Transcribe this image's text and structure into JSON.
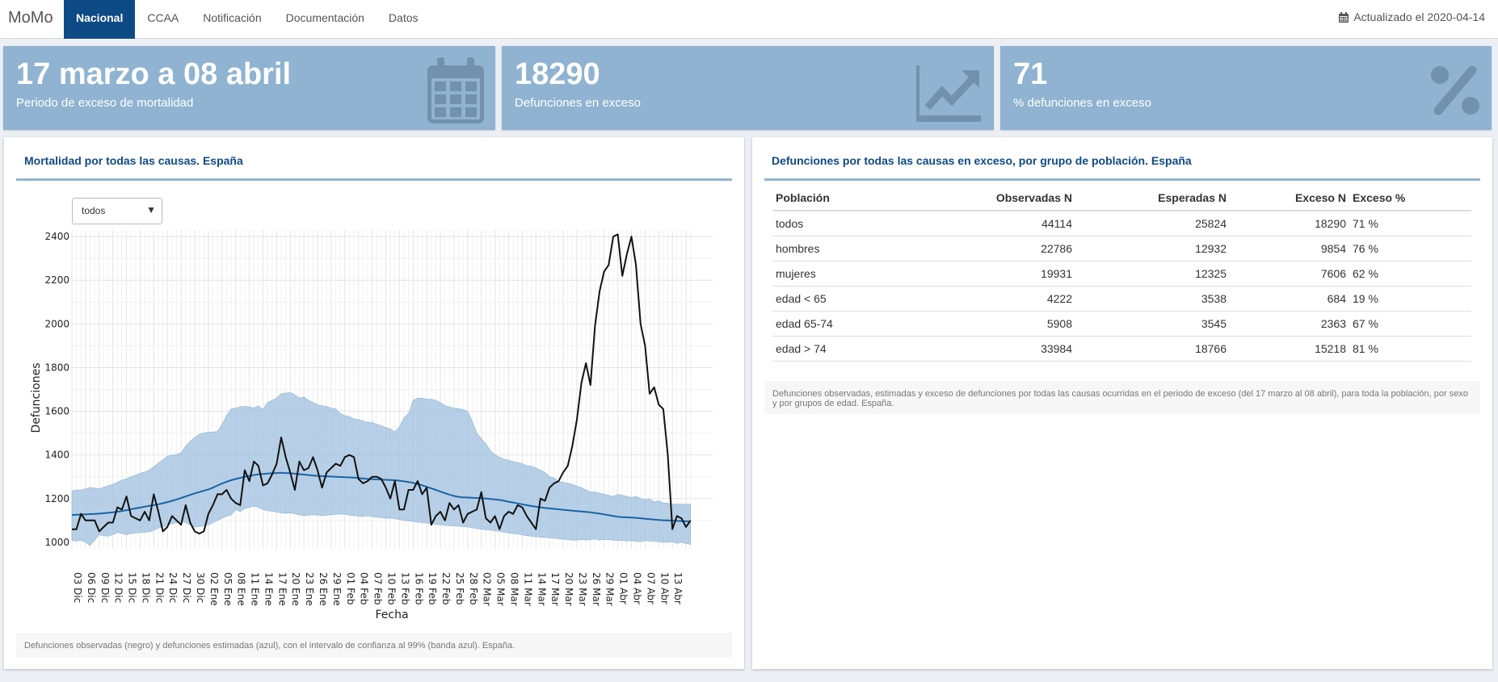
{
  "navbar": {
    "brand": "MoMo",
    "items": [
      {
        "label": "Nacional",
        "active": true
      },
      {
        "label": "CCAA"
      },
      {
        "label": "Notificación"
      },
      {
        "label": "Documentación"
      },
      {
        "label": "Datos"
      }
    ],
    "updated": "Actualizado el 2020-04-14"
  },
  "valueboxes": [
    {
      "value": "17 marzo a 08 abril",
      "subtitle": "Periodo de exceso de mortalidad",
      "icon": "calendar-icon"
    },
    {
      "value": "18290",
      "subtitle": "Defunciones en exceso",
      "icon": "chart-line-icon"
    },
    {
      "value": "71",
      "subtitle": "% defunciones en exceso",
      "icon": "percent-icon"
    }
  ],
  "colors": {
    "accent": "#0e4a86",
    "valuebox": "#8fb3d1",
    "band": "#9fc0df",
    "estimate": "#1a63a6",
    "observed": "#111111"
  },
  "left_panel": {
    "title": "Mortalidad por todas las causas. España",
    "select_value": "todos",
    "footer": "Defunciones observadas (negro) y defunciones estimadas (azul), con el intervalo de confianza al 99% (banda azul). España."
  },
  "right_panel": {
    "title": "Defunciones por todas las causas en exceso, por grupo de población. España",
    "table": {
      "headers": [
        "Población",
        "Observadas N",
        "Esperadas N",
        "Exceso N",
        "Exceso %"
      ],
      "rows": [
        [
          "todos",
          "44114",
          "25824",
          "18290",
          "71 %"
        ],
        [
          "hombres",
          "22786",
          "12932",
          "9854",
          "76 %"
        ],
        [
          "mujeres",
          "19931",
          "12325",
          "7606",
          "62 %"
        ],
        [
          "edad < 65",
          "4222",
          "3538",
          "684",
          "19 %"
        ],
        [
          "edad 65-74",
          "5908",
          "3545",
          "2363",
          "67 %"
        ],
        [
          "edad > 74",
          "33984",
          "18766",
          "15218",
          "81 %"
        ]
      ]
    },
    "footer": "Defunciones observadas, estimadas y exceso de defunciones por todas las causas ocurridas en el periodo de exceso (del 17 marzo al 08 abril), para toda la población, por sexo y por grupos de edad. España."
  },
  "chart_data": {
    "type": "line",
    "xlabel": "Fecha",
    "ylabel": "Defunciones",
    "ylim": [
      970,
      2430
    ],
    "yticks": [
      1000,
      1200,
      1400,
      1600,
      1800,
      2000,
      2200,
      2400
    ],
    "x_ticks": [
      "03 Dic",
      "06 Dic",
      "09 Dic",
      "12 Dic",
      "15 Dic",
      "18 Dic",
      "21 Dic",
      "24 Dic",
      "27 Dic",
      "30 Dic",
      "02 Ene",
      "05 Ene",
      "08 Ene",
      "11 Ene",
      "14 Ene",
      "17 Ene",
      "20 Ene",
      "23 Ene",
      "26 Ene",
      "29 Ene",
      "01 Feb",
      "04 Feb",
      "07 Feb",
      "10 Feb",
      "13 Feb",
      "16 Feb",
      "19 Feb",
      "22 Feb",
      "25 Feb",
      "28 Feb",
      "02 Mar",
      "05 Mar",
      "08 Mar",
      "11 Mar",
      "14 Mar",
      "17 Mar",
      "20 Mar",
      "23 Mar",
      "26 Mar",
      "29 Mar",
      "01 Abr",
      "04 Abr",
      "07 Abr",
      "10 Abr",
      "13 Abr"
    ],
    "grid": true,
    "series": [
      {
        "name": "observadas",
        "daily_from": "2019-12-03",
        "values": [
          1060,
          1060,
          1130,
          1100,
          1100,
          1100,
          1050,
          1070,
          1090,
          1090,
          1160,
          1150,
          1210,
          1120,
          1110,
          1100,
          1140,
          1100,
          1220,
          1140,
          1050,
          1070,
          1120,
          1100,
          1080,
          1170,
          1090,
          1050,
          1040,
          1050,
          1130,
          1170,
          1220,
          1220,
          1240,
          1200,
          1180,
          1170,
          1330,
          1280,
          1370,
          1350,
          1260,
          1270,
          1310,
          1360,
          1480,
          1390,
          1320,
          1240,
          1370,
          1330,
          1340,
          1390,
          1330,
          1250,
          1320,
          1340,
          1360,
          1350,
          1390,
          1400,
          1390,
          1290,
          1270,
          1280,
          1300,
          1300,
          1290,
          1250,
          1200,
          1280,
          1150,
          1150,
          1240,
          1240,
          1280,
          1220,
          1250,
          1080,
          1120,
          1140,
          1100,
          1180,
          1150,
          1170,
          1090,
          1130,
          1140,
          1150,
          1230,
          1110,
          1090,
          1120,
          1060,
          1120,
          1140,
          1130,
          1170,
          1160,
          1120,
          1090,
          1060,
          1200,
          1190,
          1250,
          1270,
          1280,
          1320,
          1350,
          1440,
          1560,
          1730,
          1820,
          1720,
          1990,
          2150,
          2240,
          2270,
          2400,
          2410,
          2220,
          2320,
          2400,
          2270,
          2000,
          1900,
          1680,
          1710,
          1630,
          1610,
          1400,
          1060,
          1120,
          1110,
          1070,
          1100
        ]
      },
      {
        "name": "estimadas",
        "daily_from": "2019-12-03",
        "values": [
          1125,
          1126,
          1127,
          1128,
          1129,
          1130,
          1131,
          1133,
          1135,
          1137,
          1140,
          1143,
          1147,
          1151,
          1155,
          1159,
          1163,
          1167,
          1170,
          1174,
          1179,
          1184,
          1190,
          1196,
          1203,
          1210,
          1217,
          1224,
          1230,
          1236,
          1242,
          1250,
          1260,
          1269,
          1277,
          1284,
          1290,
          1295,
          1300,
          1304,
          1308,
          1311,
          1313,
          1315,
          1316,
          1317,
          1318,
          1317,
          1316,
          1314,
          1312,
          1310,
          1308,
          1306,
          1304,
          1303,
          1302,
          1301,
          1300,
          1299,
          1298,
          1297,
          1296,
          1294,
          1292,
          1290,
          1289,
          1288,
          1287,
          1286,
          1285,
          1284,
          1282,
          1279,
          1276,
          1272,
          1267,
          1261,
          1254,
          1247,
          1240,
          1232,
          1225,
          1218,
          1212,
          1208,
          1206,
          1205,
          1204,
          1203,
          1202,
          1200,
          1198,
          1196,
          1194,
          1190,
          1186,
          1182,
          1178,
          1174,
          1170,
          1166,
          1163,
          1160,
          1157,
          1155,
          1153,
          1151,
          1149,
          1147,
          1145,
          1143,
          1141,
          1139,
          1137,
          1134,
          1131,
          1128,
          1124,
          1120,
          1117,
          1115,
          1114,
          1113,
          1112,
          1110,
          1108,
          1106,
          1104,
          1102,
          1101,
          1100,
          1099,
          1098,
          1097,
          1096,
          1096
        ]
      },
      {
        "name": "banda_sup",
        "daily_from": "2019-12-03",
        "values": [
          1235,
          1240,
          1240,
          1245,
          1250,
          1248,
          1245,
          1252,
          1260,
          1265,
          1275,
          1285,
          1290,
          1300,
          1308,
          1316,
          1322,
          1330,
          1346,
          1362,
          1378,
          1394,
          1398,
          1402,
          1410,
          1440,
          1462,
          1480,
          1495,
          1500,
          1505,
          1505,
          1508,
          1540,
          1580,
          1610,
          1615,
          1620,
          1622,
          1620,
          1615,
          1625,
          1608,
          1640,
          1650,
          1660,
          1680,
          1683,
          1686,
          1675,
          1660,
          1665,
          1650,
          1640,
          1630,
          1625,
          1622,
          1615,
          1610,
          1590,
          1580,
          1575,
          1565,
          1562,
          1555,
          1550,
          1548,
          1540,
          1535,
          1525,
          1520,
          1505,
          1530,
          1570,
          1590,
          1650,
          1660,
          1660,
          1655,
          1655,
          1650,
          1640,
          1625,
          1620,
          1615,
          1612,
          1608,
          1600,
          1555,
          1500,
          1475,
          1450,
          1420,
          1400,
          1390,
          1380,
          1376,
          1370,
          1365,
          1360,
          1350,
          1348,
          1340,
          1330,
          1320,
          1300,
          1295,
          1280,
          1275,
          1270,
          1265,
          1258,
          1250,
          1240,
          1230,
          1230,
          1225,
          1220,
          1215,
          1210,
          1220,
          1215,
          1210,
          1205,
          1210,
          1200,
          1195,
          1198,
          1185,
          1190,
          1180,
          1178,
          1175,
          1175,
          1175,
          1175,
          1175
        ]
      },
      {
        "name": "banda_inf",
        "daily_from": "2019-12-03",
        "values": [
          1010,
          1005,
          1010,
          1000,
          985,
          1010,
          1035,
          1030,
          1028,
          1035,
          1045,
          1040,
          1035,
          1040,
          1042,
          1044,
          1046,
          1048,
          1055,
          1065,
          1070,
          1078,
          1085,
          1090,
          1095,
          1090,
          1080,
          1070,
          1072,
          1075,
          1080,
          1090,
          1100,
          1110,
          1120,
          1125,
          1150,
          1140,
          1155,
          1160,
          1165,
          1160,
          1150,
          1145,
          1142,
          1138,
          1135,
          1133,
          1135,
          1130,
          1126,
          1122,
          1124,
          1126,
          1125,
          1122,
          1124,
          1126,
          1128,
          1130,
          1127,
          1124,
          1122,
          1120,
          1118,
          1122,
          1118,
          1115,
          1113,
          1110,
          1111,
          1108,
          1104,
          1100,
          1098,
          1095,
          1092,
          1090,
          1088,
          1086,
          1082,
          1080,
          1078,
          1076,
          1075,
          1074,
          1072,
          1070,
          1066,
          1063,
          1060,
          1058,
          1055,
          1052,
          1050,
          1046,
          1042,
          1040,
          1038,
          1034,
          1030,
          1028,
          1026,
          1024,
          1022,
          1020,
          1018,
          1016,
          1014,
          1012,
          1010,
          1010,
          1012,
          1010,
          1012,
          1015,
          1010,
          1013,
          1012,
          1010,
          1008,
          1008,
          1005,
          1008,
          1004,
          1002,
          1008,
          1006,
          1005,
          1002,
          1000,
          1000,
          1002,
          995,
          1000,
          995,
          990
        ]
      }
    ]
  }
}
